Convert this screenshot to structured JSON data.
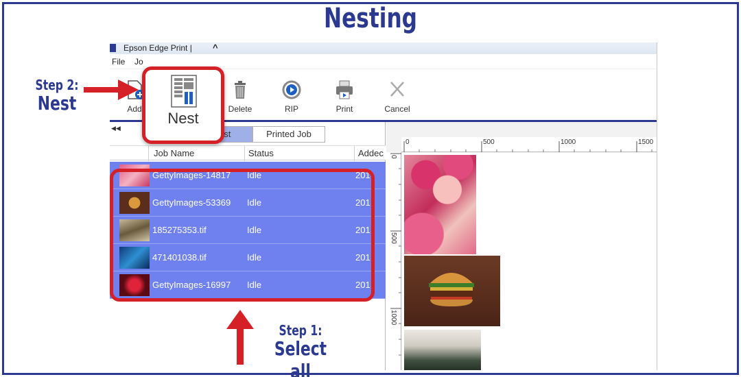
{
  "title": "Nesting",
  "app": {
    "window_title": "Epson Edge Print |",
    "title_caret": "^",
    "menu": {
      "file": "File",
      "job": "Jo"
    }
  },
  "toolbar": {
    "add_label": "Add",
    "nest_label": "Nest",
    "delete_label": "Delete",
    "rip_label": "RIP",
    "print_label": "Print",
    "cancel_label": "Cancel"
  },
  "tabs": {
    "job_list": "Job List",
    "printed_job": "Printed Job"
  },
  "columns": {
    "job_name": "Job Name",
    "status": "Status",
    "added": "Addec"
  },
  "jobs": [
    {
      "name": "GettyImages-14817",
      "status": "Idle",
      "added": "201"
    },
    {
      "name": "GettyImages-53369",
      "status": "Idle",
      "added": "201"
    },
    {
      "name": "185275353.tif",
      "status": "Idle",
      "added": "201"
    },
    {
      "name": "471401038.tif",
      "status": "Idle",
      "added": "201"
    },
    {
      "name": "GettyImages-16997",
      "status": "Idle",
      "added": "201"
    }
  ],
  "ruler": {
    "top": [
      "0",
      "500",
      "1000",
      "1500"
    ],
    "left": [
      "0",
      "500",
      "1000"
    ]
  },
  "annotations": {
    "step2_small": "Step 2:",
    "step2_big": "Nest",
    "step1_small": "Step 1:",
    "step1_big": "Select all"
  },
  "colors": {
    "brand_blue": "#2b3990",
    "highlight_red": "#d52027",
    "selection_blue": "#6f80ef"
  }
}
